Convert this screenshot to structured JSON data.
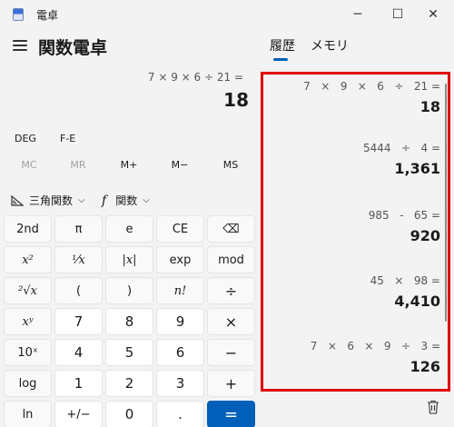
{
  "window": {
    "title": "電卓",
    "minimize": "─",
    "maximize": "☐",
    "close": "✕"
  },
  "header": {
    "mode_title": "関数電卓"
  },
  "tabs": [
    "履歴",
    "メモリ"
  ],
  "display": {
    "expression": "7 × 9 × 6 ÷ 21 =",
    "value": "18"
  },
  "angle": {
    "deg": "DEG",
    "fe": "F-E"
  },
  "memory": [
    "MC",
    "MR",
    "M+",
    "M−",
    "MS"
  ],
  "functions": {
    "trig": "三角関数",
    "func_symbol": "f",
    "func": "関数"
  },
  "keys": [
    [
      "2nd",
      "π",
      "e",
      "CE",
      "⌫"
    ],
    [
      "x²",
      "¹⁄x",
      "|x|",
      "exp",
      "mod"
    ],
    [
      "²√x",
      "(",
      ")",
      "n!",
      "÷"
    ],
    [
      "xʸ",
      "7",
      "8",
      "9",
      "×"
    ],
    [
      "10ˣ",
      "4",
      "5",
      "6",
      "−"
    ],
    [
      "log",
      "1",
      "2",
      "3",
      "+"
    ],
    [
      "ln",
      "+/−",
      "0",
      ".",
      "="
    ]
  ],
  "history": [
    {
      "expression": "7   ×   9   ×   6   ÷   21 =",
      "result": "18"
    },
    {
      "expression": "5444   ÷   4 =",
      "result": "1,361"
    },
    {
      "expression": "985   -   65 =",
      "result": "920"
    },
    {
      "expression": "45   ×   98 =",
      "result": "4,410"
    },
    {
      "expression": "7   ×   6   ×   9   ÷   3 =",
      "result": "126"
    }
  ],
  "colors": {
    "accent": "#005fb8",
    "highlight_border": "#e00000",
    "background": "#f3f3f3"
  }
}
